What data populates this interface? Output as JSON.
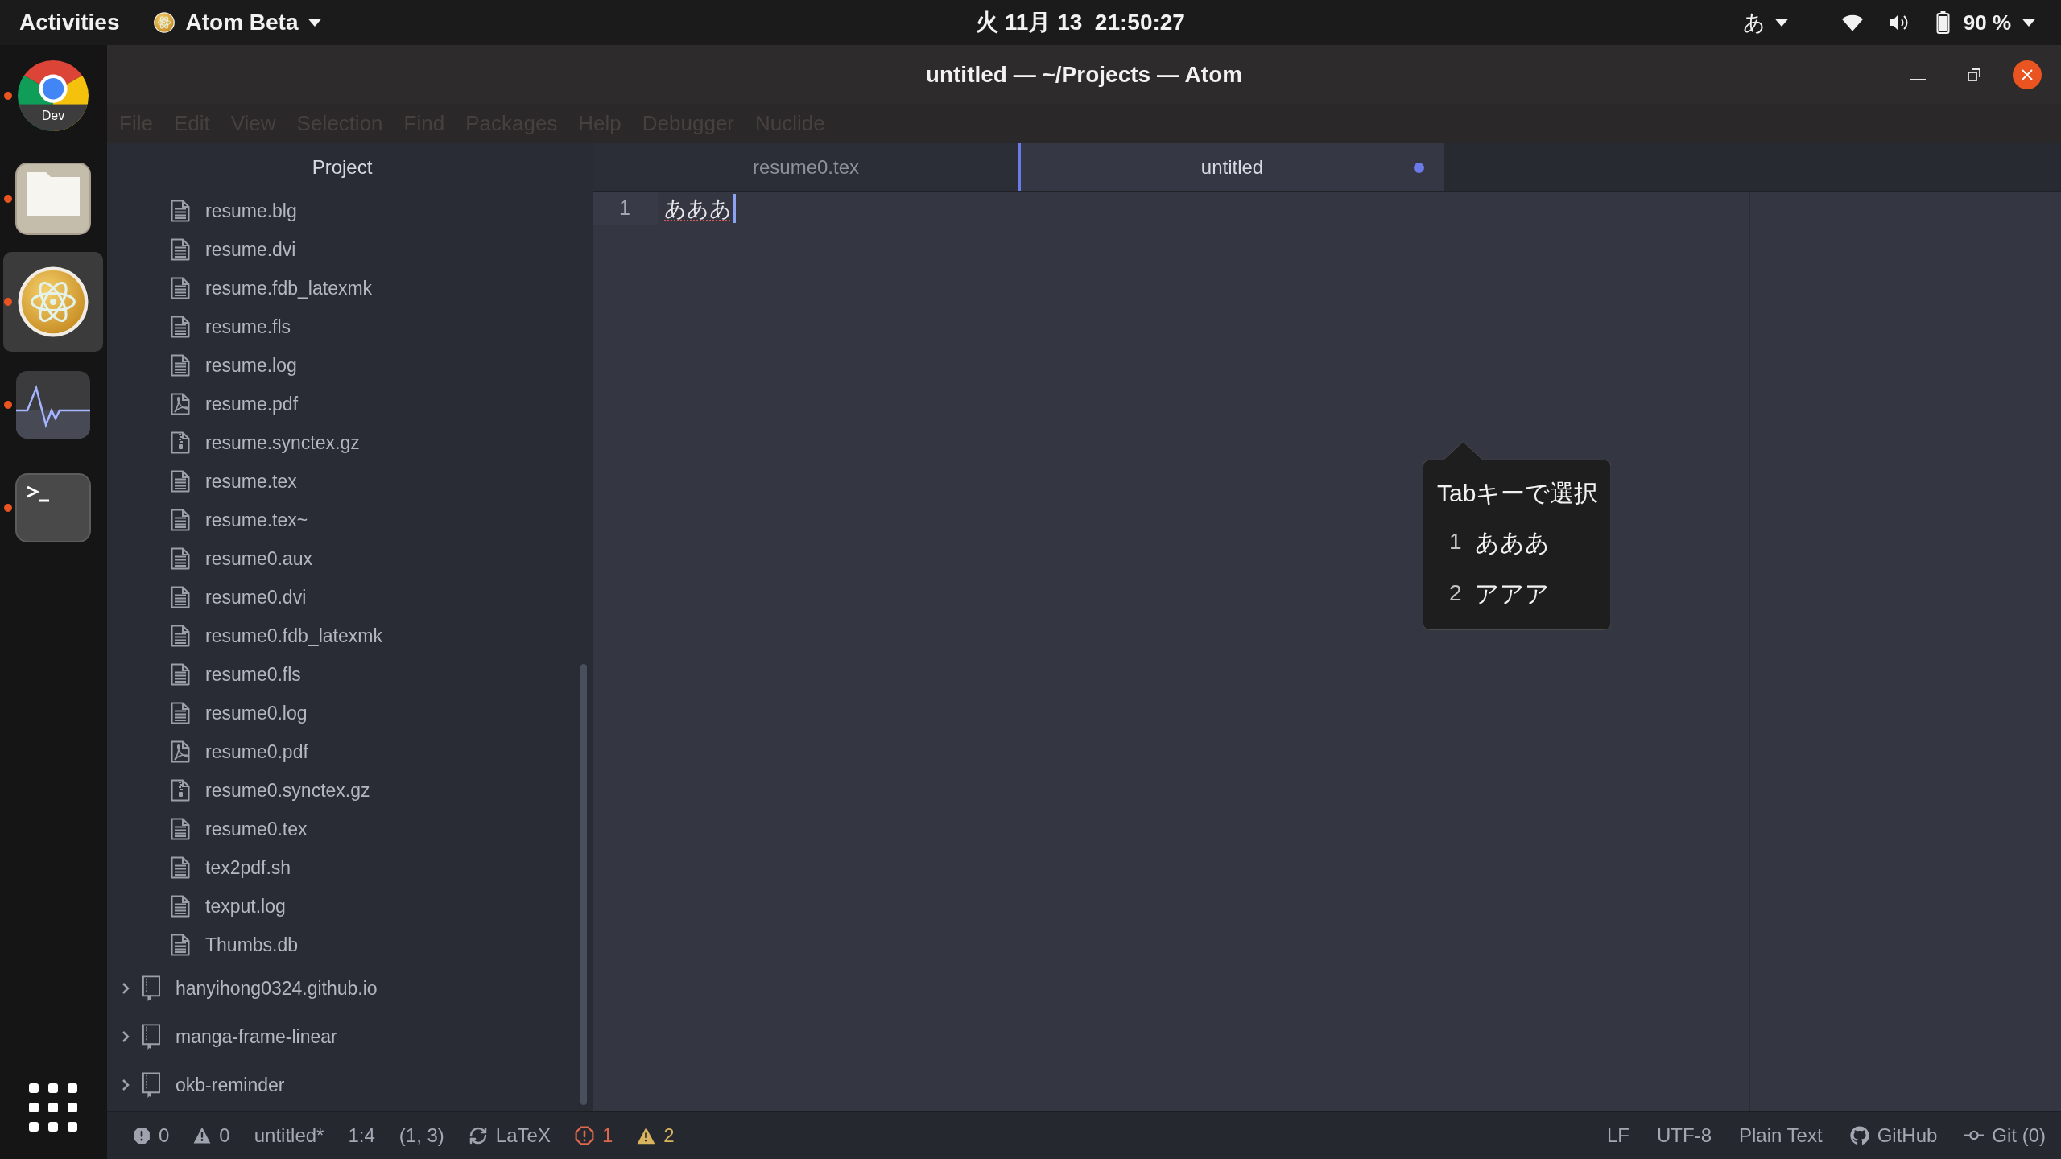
{
  "top_bar": {
    "activities": "Activities",
    "app_menu": "Atom Beta",
    "clock": "火 11月 13  21:50:27",
    "input_method": "あ",
    "battery": "90 %"
  },
  "dock": {
    "items": [
      {
        "kind": "browser",
        "badge": "Dev",
        "running": true,
        "selected": false
      },
      {
        "kind": "files",
        "running": true,
        "selected": false
      },
      {
        "kind": "atom",
        "running": true,
        "selected": true
      },
      {
        "kind": "monitor",
        "running": true,
        "selected": false
      },
      {
        "kind": "terminal",
        "running": true,
        "selected": false
      }
    ]
  },
  "window": {
    "title": "untitled — ~/Projects — Atom"
  },
  "menu_bar": [
    "File",
    "Edit",
    "View",
    "Selection",
    "Find",
    "Packages",
    "Help",
    "Debugger",
    "Nuclide"
  ],
  "tree_view": {
    "title": "Project",
    "files": [
      {
        "name": "resume.blg",
        "kind": "text"
      },
      {
        "name": "resume.dvi",
        "kind": "text"
      },
      {
        "name": "resume.fdb_latexmk",
        "kind": "text"
      },
      {
        "name": "resume.fls",
        "kind": "text"
      },
      {
        "name": "resume.log",
        "kind": "text"
      },
      {
        "name": "resume.pdf",
        "kind": "pdf"
      },
      {
        "name": "resume.synctex.gz",
        "kind": "zip"
      },
      {
        "name": "resume.tex",
        "kind": "text"
      },
      {
        "name": "resume.tex~",
        "kind": "text"
      },
      {
        "name": "resume0.aux",
        "kind": "text"
      },
      {
        "name": "resume0.dvi",
        "kind": "text"
      },
      {
        "name": "resume0.fdb_latexmk",
        "kind": "text"
      },
      {
        "name": "resume0.fls",
        "kind": "text"
      },
      {
        "name": "resume0.log",
        "kind": "text"
      },
      {
        "name": "resume0.pdf",
        "kind": "pdf"
      },
      {
        "name": "resume0.synctex.gz",
        "kind": "zip"
      },
      {
        "name": "resume0.tex",
        "kind": "text"
      },
      {
        "name": "tex2pdf.sh",
        "kind": "text"
      },
      {
        "name": "texput.log",
        "kind": "text"
      },
      {
        "name": "Thumbs.db",
        "kind": "text"
      }
    ],
    "folders": [
      {
        "name": "hanyihong0324.github.io",
        "expanded": false
      },
      {
        "name": "manga-frame-linear",
        "expanded": false
      },
      {
        "name": "okb-reminder",
        "expanded": false
      }
    ]
  },
  "tabs": [
    {
      "label": "resume0.tex",
      "selected": false,
      "modified": false
    },
    {
      "label": "untitled",
      "selected": true,
      "modified": true
    }
  ],
  "editor": {
    "lines": [
      {
        "number": "1",
        "text": "あああ",
        "composing": true
      }
    ]
  },
  "candidate_window": {
    "title": "Tabキーで選択",
    "candidates": [
      {
        "number": "1",
        "text": "あああ"
      },
      {
        "number": "2",
        "text": "アアア"
      }
    ]
  },
  "status_bar": {
    "left": [
      {
        "kind": "error_count",
        "text": "0"
      },
      {
        "kind": "warning_count",
        "text": "0"
      },
      {
        "kind": "file",
        "text": "untitled*"
      },
      {
        "kind": "cursor",
        "text": "1:4"
      },
      {
        "kind": "position",
        "text": "(1, 3)"
      },
      {
        "kind": "grammar_check",
        "text": "LaTeX"
      },
      {
        "kind": "lint_error",
        "text": "1"
      },
      {
        "kind": "lint_warning",
        "text": "2"
      }
    ],
    "right": [
      {
        "kind": "line_ending",
        "text": "LF"
      },
      {
        "kind": "encoding",
        "text": "UTF-8"
      },
      {
        "kind": "grammar",
        "text": "Plain Text"
      },
      {
        "kind": "github",
        "text": "GitHub"
      },
      {
        "kind": "git",
        "text": "Git (0)"
      }
    ]
  }
}
